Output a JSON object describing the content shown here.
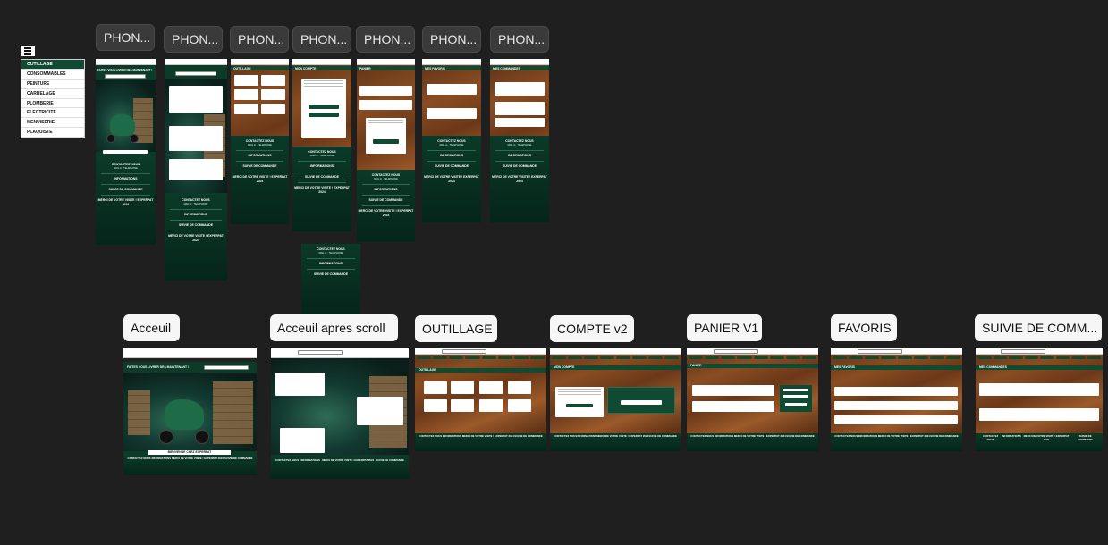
{
  "menu": {
    "categories": [
      "OUTILLAGE",
      "CONSOMMABLES",
      "PEINTURE",
      "CARRELAGE",
      "PLOMBERIE",
      "ELECTRICITÉ",
      "MENUISERIE",
      "PLAQUISTE"
    ]
  },
  "phone_labels": [
    "PHON...",
    "PHON...",
    "PHON...",
    "PHON...",
    "PHON...",
    "PHON...",
    "PHON..."
  ],
  "desktop_labels": [
    "Acceuil",
    "Acceuil apres scroll",
    "OUTILLAGE",
    "COMPTE v2",
    "PANIER V1",
    "FAVORIS",
    "SUIVIE DE COMM..."
  ],
  "mockup_text": {
    "deliver": "FAITES VOUS LIVRER DES MAINTENANT !",
    "search_placeholder": "Recherchez votre produit",
    "welcome": "BIENVENUE CHEZ EXPERPAT",
    "contact": "CONTACTEZ NOUS",
    "informations": "INFORMATIONS",
    "suivie": "SUIVIE DE COMMANDE",
    "merci": "MERCI DE VOTRE VISITE ! EXPERPAT 2024",
    "outillage": "OUTILLAGE",
    "compte": "MON COMPTE",
    "panier": "PANIER",
    "favoris": "MES FAVORIS",
    "commandes": "MES COMMANDES"
  },
  "colors": {
    "background": "#1f1f1f",
    "brand_green": "#0f4a33",
    "footer_green": "#05251a"
  }
}
